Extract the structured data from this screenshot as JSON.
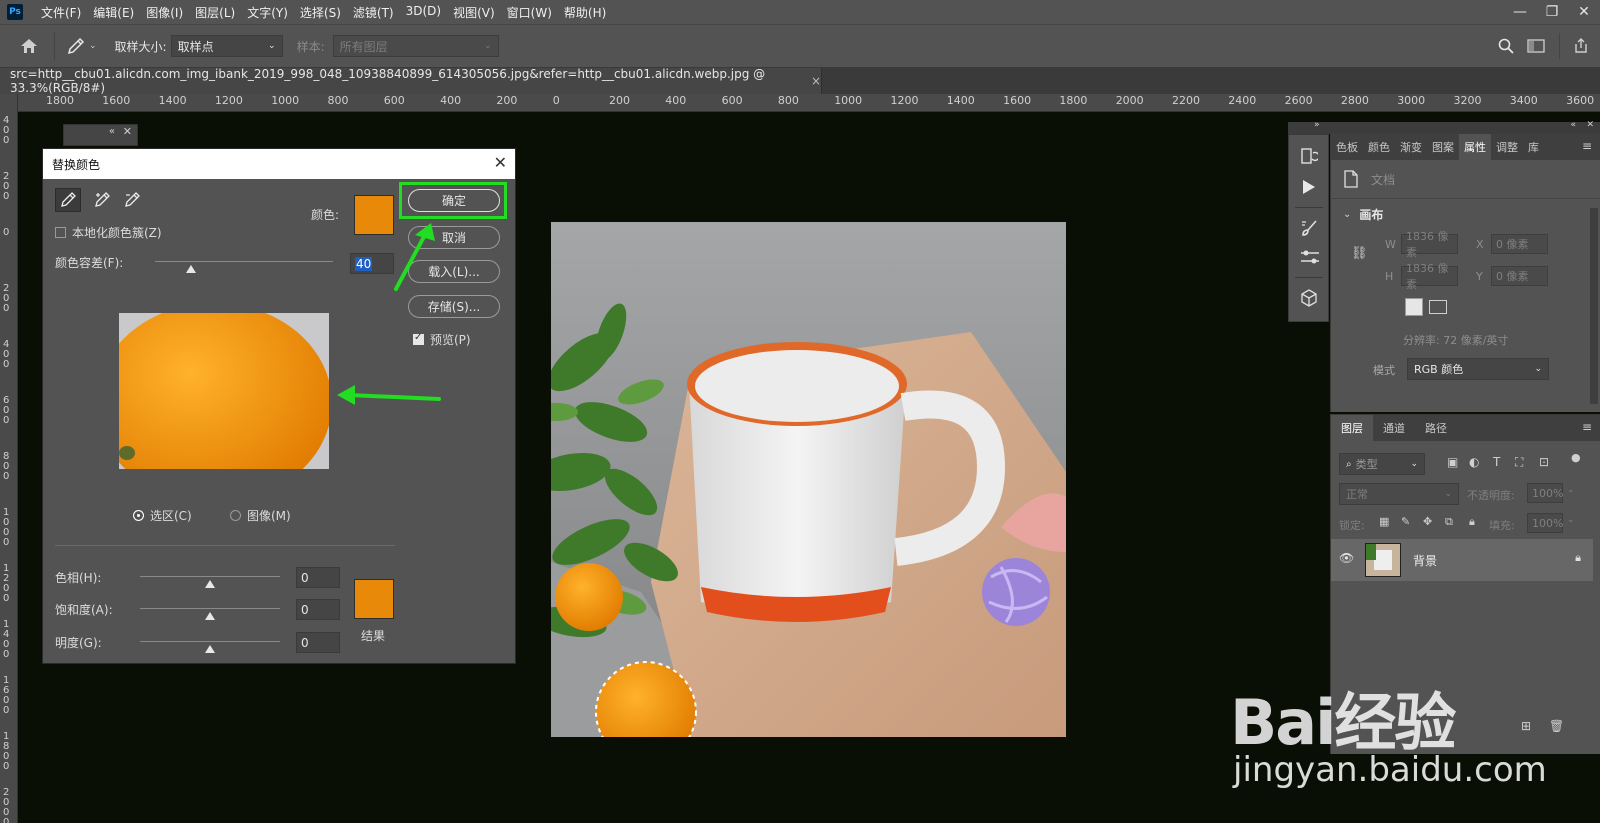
{
  "app": {
    "logo": "Ps"
  },
  "menu": [
    "文件(F)",
    "编辑(E)",
    "图像(I)",
    "图层(L)",
    "文字(Y)",
    "选择(S)",
    "滤镜(T)",
    "3D(D)",
    "视图(V)",
    "窗口(W)",
    "帮助(H)"
  ],
  "window_controls": {
    "minimize": "—",
    "restore": "❐",
    "close": "✕"
  },
  "options_bar": {
    "sample_size_label": "取样大小:",
    "sample_size_value": "取样点",
    "sample_label": "样本:",
    "sample_value": "所有图层"
  },
  "document_tab": {
    "title": "src=http__cbu01.alicdn.com_img_ibank_2019_998_048_10938840899_614305056.jpg&refer=http__cbu01.alicdn.webp.jpg @ 33.3%(RGB/8#)",
    "close": "×"
  },
  "ruler": {
    "horizontal": [
      "1800",
      "1600",
      "1400",
      "1200",
      "1000",
      "800",
      "600",
      "400",
      "200",
      "0",
      "200",
      "400",
      "600",
      "800",
      "1000",
      "1200",
      "1400",
      "1600",
      "1800",
      "2000",
      "2200",
      "2400",
      "2600",
      "2800",
      "3000",
      "3200",
      "3400",
      "3600"
    ],
    "vertical": [
      "400",
      "200",
      "0",
      "200",
      "400",
      "600",
      "800",
      "1000",
      "1200",
      "1400",
      "1600",
      "1800",
      "2000"
    ]
  },
  "dialog": {
    "title": "替换颜色",
    "close": "✕",
    "localized_label": "本地化颜色簇(Z)",
    "color_label": "颜色:",
    "tolerance_label": "颜色容差(F):",
    "tolerance_value": "40",
    "tolerance_level": 0.2,
    "buttons": {
      "ok": "确定",
      "cancel": "取消",
      "load": "载入(L)...",
      "save": "存储(S)..."
    },
    "preview_label": "预览(P)",
    "preview_checked": true,
    "radio_selection": "选区(C)",
    "radio_image": "图像(M)",
    "hue_label": "色相(H):",
    "hue_value": "0",
    "saturation_label": "饱和度(A):",
    "saturation_value": "0",
    "lightness_label": "明度(G):",
    "lightness_value": "0",
    "result_label": "结果",
    "color_swatch": "#e8890a",
    "result_swatch": "#e8890a",
    "highlight_color": "#22dd22"
  },
  "properties": {
    "tabs": [
      "色板",
      "颜色",
      "渐变",
      "图案",
      "属性",
      "调整",
      "库"
    ],
    "active_tab": "属性",
    "doc_label": "文档",
    "section": "画布",
    "w_label": "W",
    "w_value": "1836 像素",
    "x_label": "X",
    "x_value": "0 像素",
    "h_label": "H",
    "h_value": "1836 像素",
    "y_label": "Y",
    "y_value": "0 像素",
    "resolution": "分辨率: 72 像素/英寸",
    "mode_label": "模式",
    "mode_value": "RGB 颜色"
  },
  "layers": {
    "tabs": [
      "图层",
      "通道",
      "路径"
    ],
    "filter_placeholder": "类型",
    "blend_mode": "正常",
    "opacity_label": "不透明度:",
    "opacity_value": "100%",
    "lock_label": "锁定:",
    "fill_label": "填充:",
    "fill_value": "100%",
    "layer_name": "背景"
  },
  "watermark": {
    "main": "Bai经验",
    "url": "jingyan.baidu.com"
  }
}
